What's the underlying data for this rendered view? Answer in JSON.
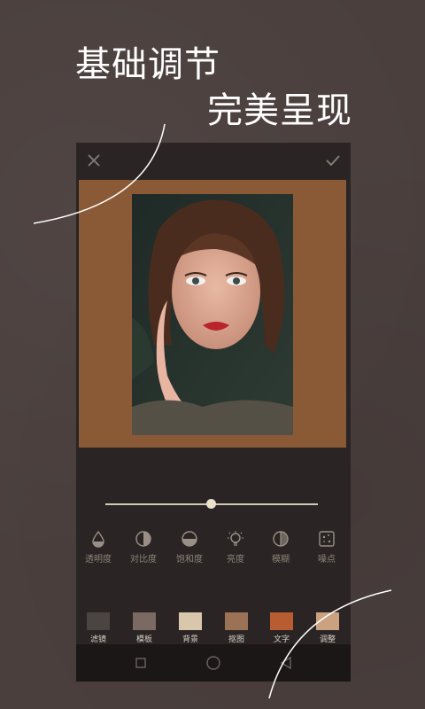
{
  "headline": {
    "line1": "基础调节",
    "line2": "完美呈现"
  },
  "colors": {
    "background": "#4a3f3d",
    "canvas": "#8a5a37",
    "accent": "#e9e1c9"
  },
  "topbar": {
    "close_icon": "close-icon",
    "confirm_icon": "check-icon"
  },
  "slider": {
    "value": 0.5
  },
  "adjustments": [
    {
      "label": "透明度",
      "icon": "drop-icon"
    },
    {
      "label": "对比度",
      "icon": "contrast-icon"
    },
    {
      "label": "饱和度",
      "icon": "saturation-icon"
    },
    {
      "label": "亮度",
      "icon": "bulb-icon"
    },
    {
      "label": "模糊",
      "icon": "blur-icon"
    },
    {
      "label": "噪点",
      "icon": "noise-icon"
    }
  ],
  "tools": [
    {
      "label": "滤镜",
      "color": "#4b4442"
    },
    {
      "label": "模板",
      "color": "#7b6a63"
    },
    {
      "label": "背景",
      "color": "#d9c7ab"
    },
    {
      "label": "抠图",
      "color": "#9c7257"
    },
    {
      "label": "文字",
      "color": "#b85d32"
    },
    {
      "label": "调整",
      "color": "#caa27f"
    }
  ],
  "navbar": {
    "recent": "square-icon",
    "home": "circle-icon",
    "back": "triangle-back-icon"
  }
}
